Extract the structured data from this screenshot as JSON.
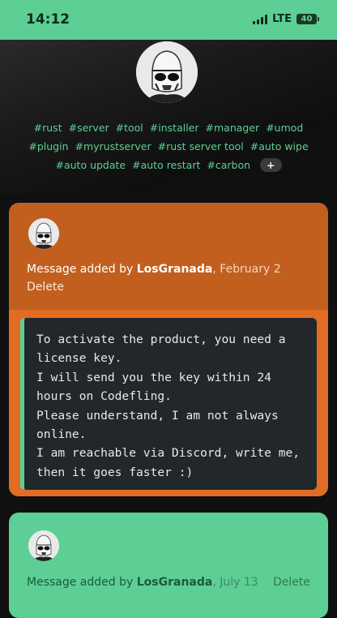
{
  "status_bar": {
    "time": "14:12",
    "network": "LTE",
    "battery": "40"
  },
  "tags": [
    "#rust",
    "#server",
    "#tool",
    "#installer",
    "#manager",
    "#umod",
    "#plugin",
    "#myrustserver",
    "#rust server tool",
    "#auto wipe",
    "#auto update",
    "#auto restart",
    "#carbon"
  ],
  "tags_more_label": "+",
  "messages": [
    {
      "prefix": "Message added by ",
      "author": "LosGranada",
      "date": ", February 2",
      "delete_label": "Delete",
      "body_lines": [
        "To activate the product, you need a",
        "license key.",
        "I will send you the key within 24",
        "hours on Codefling.",
        "Please understand, I am not always",
        "online.",
        "I am reachable via Discord, write me,",
        "then it goes faster :)"
      ]
    },
    {
      "prefix": "Message added by ",
      "author": "LosGranada",
      "date": ", July 13",
      "delete_label": "Delete"
    }
  ],
  "colors": {
    "accent_green": "#5dcf94",
    "orange": "#e06d23",
    "dark_orange": "#c25f1e"
  }
}
